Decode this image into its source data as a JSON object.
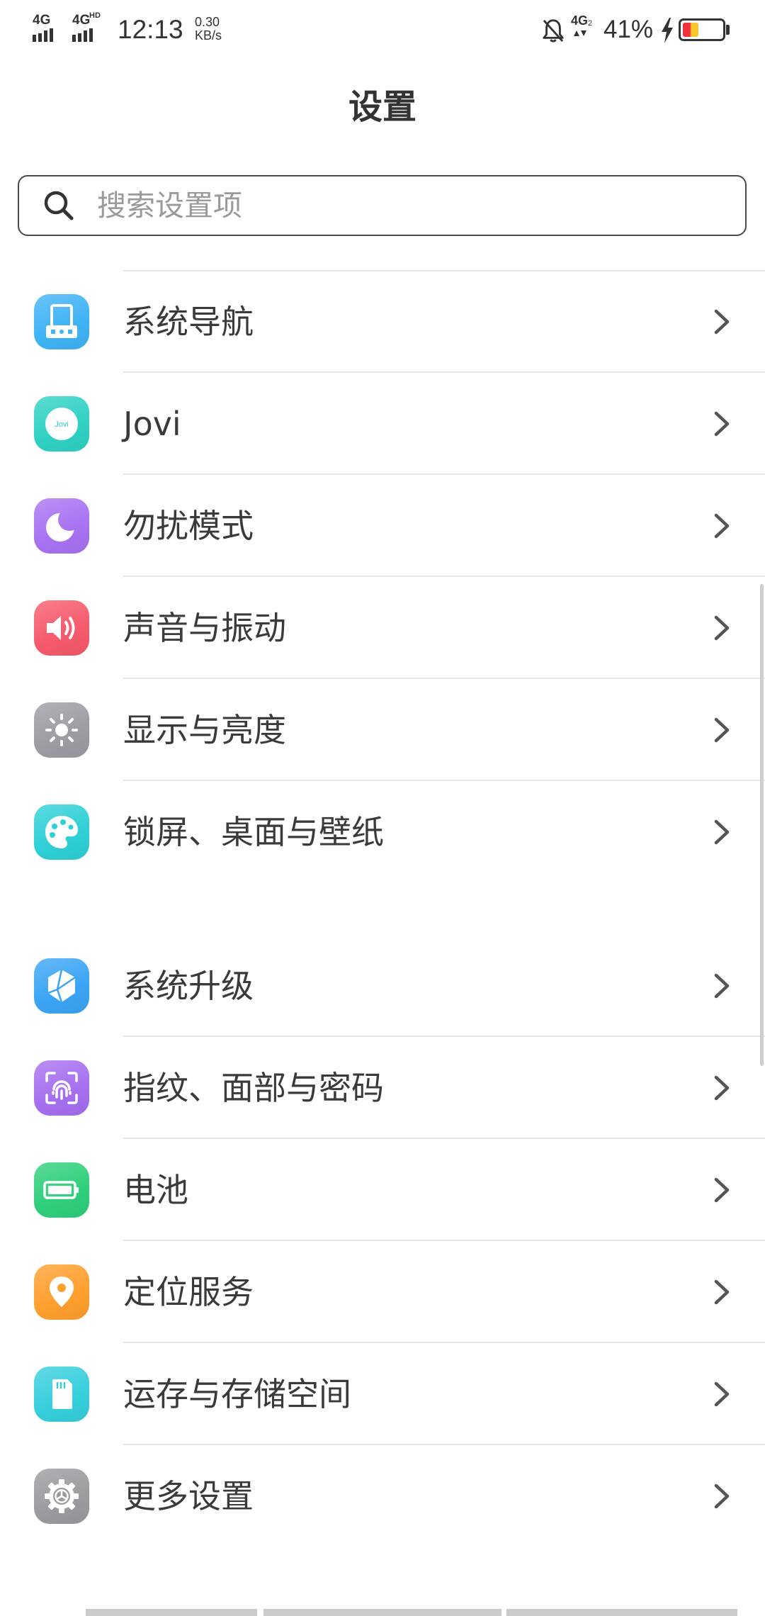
{
  "status_bar": {
    "sim1_network": "4G",
    "sim2_network": "4G",
    "sim2_badge": "HD",
    "time": "12:13",
    "net_speed_value": "0.30",
    "net_speed_unit": "KB/s",
    "mute_icon": "bell-off-icon",
    "data_network": "4G",
    "data_network_sub": "2",
    "battery_percent": "41%",
    "battery_level": 0.41,
    "charging": true
  },
  "header": {
    "title": "设置"
  },
  "search": {
    "placeholder": "搜索设置项",
    "icon": "search-icon"
  },
  "groups": [
    {
      "items": [
        {
          "label": "系统导航",
          "icon": "system-navigation-icon",
          "color": "#3fb3f6"
        },
        {
          "label": "Jovi",
          "icon": "jovi-icon",
          "icon_text": "Jovi",
          "color": "#2fd1c4"
        },
        {
          "label": "勿扰模式",
          "icon": "moon-icon",
          "color": "#a872f2"
        },
        {
          "label": "声音与振动",
          "icon": "speaker-icon",
          "color": "#f65a6c"
        },
        {
          "label": "显示与亮度",
          "icon": "sun-icon",
          "color": "#9c9ca3"
        },
        {
          "label": "锁屏、桌面与壁纸",
          "icon": "palette-icon",
          "color": "#2ed0d6"
        }
      ]
    },
    {
      "items": [
        {
          "label": "系统升级",
          "icon": "system-update-icon",
          "color": "#3aa5f5"
        },
        {
          "label": "指纹、面部与密码",
          "icon": "fingerprint-icon",
          "color": "#a66ff0"
        },
        {
          "label": "电池",
          "icon": "battery-icon",
          "color": "#2fcf7c"
        },
        {
          "label": "定位服务",
          "icon": "location-pin-icon",
          "color": "#ff9f2e"
        },
        {
          "label": "运存与存储空间",
          "icon": "sd-card-icon",
          "color": "#36cfdc"
        },
        {
          "label": "更多设置",
          "icon": "gear-icon",
          "color": "#9b9ba0"
        }
      ]
    }
  ]
}
